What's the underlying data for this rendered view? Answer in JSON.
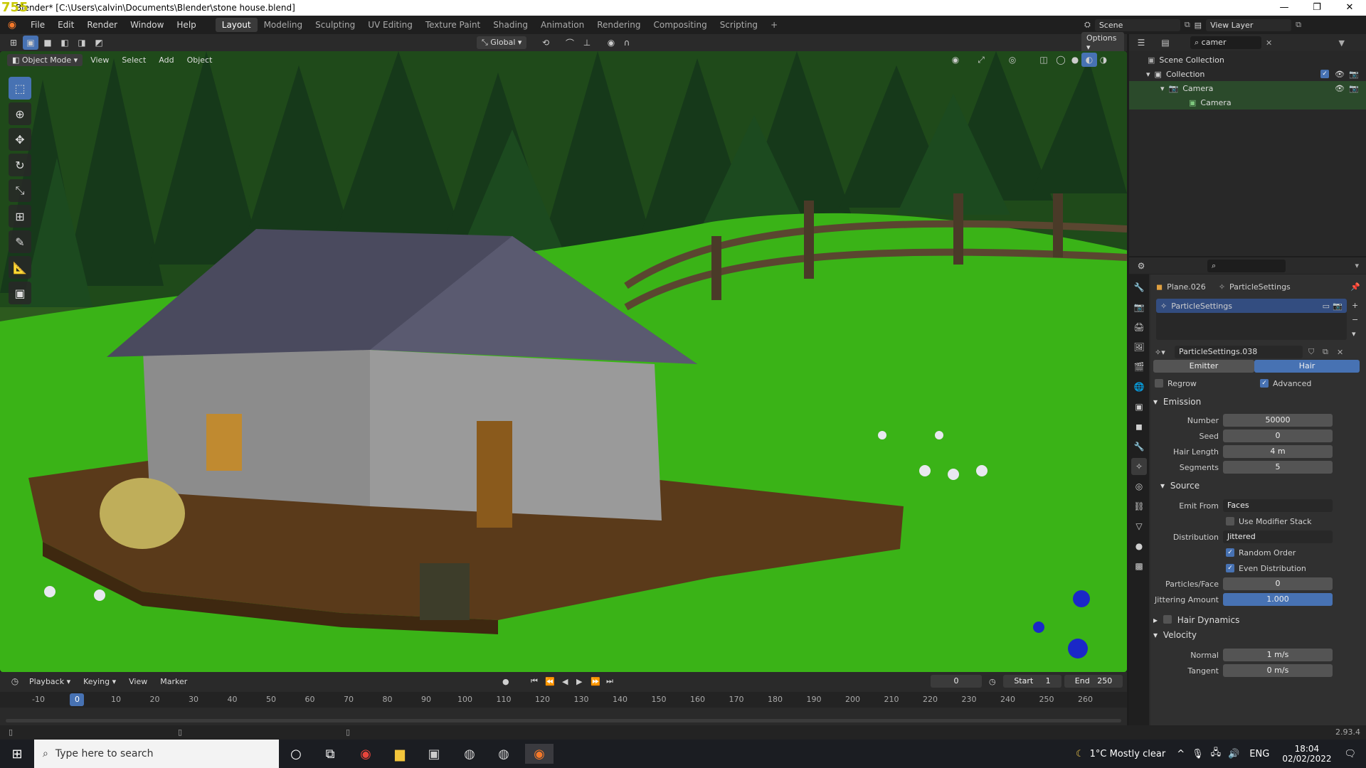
{
  "window": {
    "fps": "755",
    "title": "Blender* [C:\\Users\\calvin\\Documents\\Blender\\stone house.blend]",
    "minimize": "—",
    "maximize": "❐",
    "close": "✕"
  },
  "menu": {
    "items": [
      "File",
      "Edit",
      "Render",
      "Window",
      "Help"
    ],
    "workspaces": [
      "Layout",
      "Modeling",
      "Sculpting",
      "UV Editing",
      "Texture Paint",
      "Shading",
      "Animation",
      "Rendering",
      "Compositing",
      "Scripting"
    ],
    "active_workspace": "Layout",
    "add_workspace": "+",
    "scene": "Scene",
    "view_layer": "View Layer"
  },
  "viewport_header": {
    "transform_orientation": "Global",
    "options": "Options",
    "mode": "Object Mode",
    "menus": [
      "View",
      "Select",
      "Add",
      "Object"
    ]
  },
  "outliner": {
    "search": "camer",
    "scene_collection": "Scene Collection",
    "collection": "Collection",
    "camera_object": "Camera",
    "camera_data": "Camera"
  },
  "properties": {
    "object": "Plane.026",
    "settings": "ParticleSettings",
    "slot": "ParticleSettings",
    "datablock": "ParticleSettings.038",
    "type_emitter": "Emitter",
    "type_hair": "Hair",
    "regrow": "Regrow",
    "advanced": "Advanced",
    "emission": "Emission",
    "number_label": "Number",
    "number": "50000",
    "seed_label": "Seed",
    "seed": "0",
    "hair_length_label": "Hair Length",
    "hair_length": "4 m",
    "segments_label": "Segments",
    "segments": "5",
    "source": "Source",
    "emit_from_label": "Emit From",
    "emit_from": "Faces",
    "use_modifier_stack": "Use Modifier Stack",
    "distribution_label": "Distribution",
    "distribution": "Jittered",
    "random_order": "Random Order",
    "even_distribution": "Even Distribution",
    "particles_face_label": "Particles/Face",
    "particles_face": "0",
    "jittering_label": "Jittering Amount",
    "jittering": "1.000",
    "hair_dynamics": "Hair Dynamics",
    "velocity": "Velocity",
    "normal_label": "Normal",
    "normal": "1 m/s",
    "tangent_label": "Tangent",
    "tangent": "0 m/s"
  },
  "timeline": {
    "menus": [
      "Playback",
      "Keying",
      "View",
      "Marker"
    ],
    "current_frame": "0",
    "start_label": "Start",
    "start": "1",
    "end_label": "End",
    "end": "250",
    "ticks": [
      "-10",
      "0",
      "10",
      "20",
      "30",
      "40",
      "50",
      "60",
      "70",
      "80",
      "90",
      "100",
      "110",
      "120",
      "130",
      "140",
      "150",
      "160",
      "170",
      "180",
      "190",
      "200",
      "210",
      "220",
      "230",
      "240",
      "250",
      "260"
    ]
  },
  "status": {
    "version": "2.93.4"
  },
  "taskbar": {
    "search_placeholder": "Type here to search",
    "weather": "1°C  Mostly clear",
    "lang": "ENG",
    "time": "18:04",
    "date": "02/02/2022"
  }
}
